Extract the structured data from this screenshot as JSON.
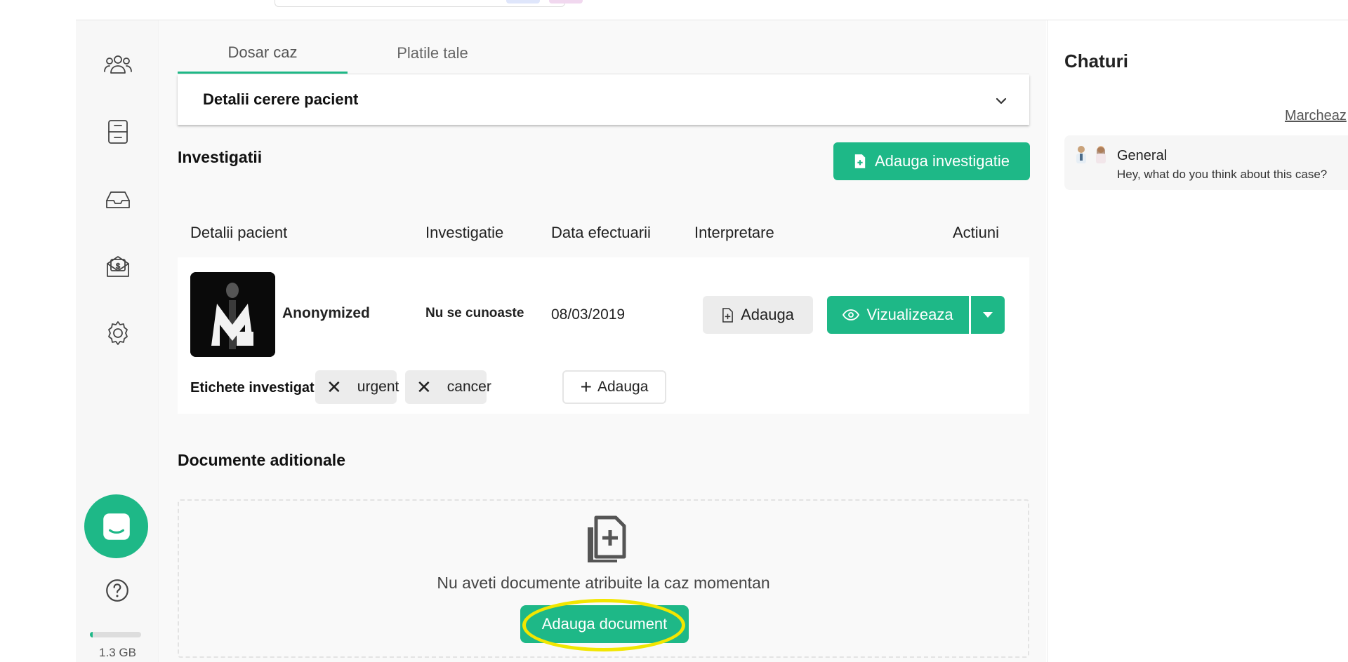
{
  "tabs": [
    {
      "label": "Dosar caz",
      "active": true
    },
    {
      "label": "Platile tale",
      "active": false
    }
  ],
  "accordion": {
    "title": "Detalii cerere pacient",
    "icon": "chevron-down-icon"
  },
  "investigations": {
    "title": "Investigatii",
    "add_button": "Adauga investigatie",
    "columns": [
      "Detalii pacient",
      "Investigatie",
      "Data efectuarii",
      "Interpretare",
      "Actiuni"
    ],
    "rows": [
      {
        "patient": "Anonymized",
        "investigation": "Nu se cunoaste",
        "date": "08/03/2019",
        "interpretation_button": "Adauga",
        "view_button": "Vizualizeaza",
        "tags_label": "Etichete investigatie:",
        "tags": [
          "urgent",
          "cancer"
        ],
        "add_tag_button": "Adauga"
      }
    ]
  },
  "documents": {
    "title": "Documente aditionale",
    "empty_message": "Nu aveti documente atribuite la caz momentan",
    "add_button": "Adauga document"
  },
  "sidebar": {
    "items": [
      "users-icon",
      "archive-icon",
      "inbox-icon",
      "payments-icon",
      "settings-icon"
    ],
    "storage_label": "1.3 GB",
    "storage_fraction": 0.05
  },
  "chats": {
    "title": "Chaturi",
    "mark_link": "Marcheaz",
    "items": [
      {
        "name": "General",
        "preview": "Hey, what do you think about this case?"
      }
    ]
  },
  "colors": {
    "accent": "#1eb887",
    "highlight": "#f2e600"
  }
}
